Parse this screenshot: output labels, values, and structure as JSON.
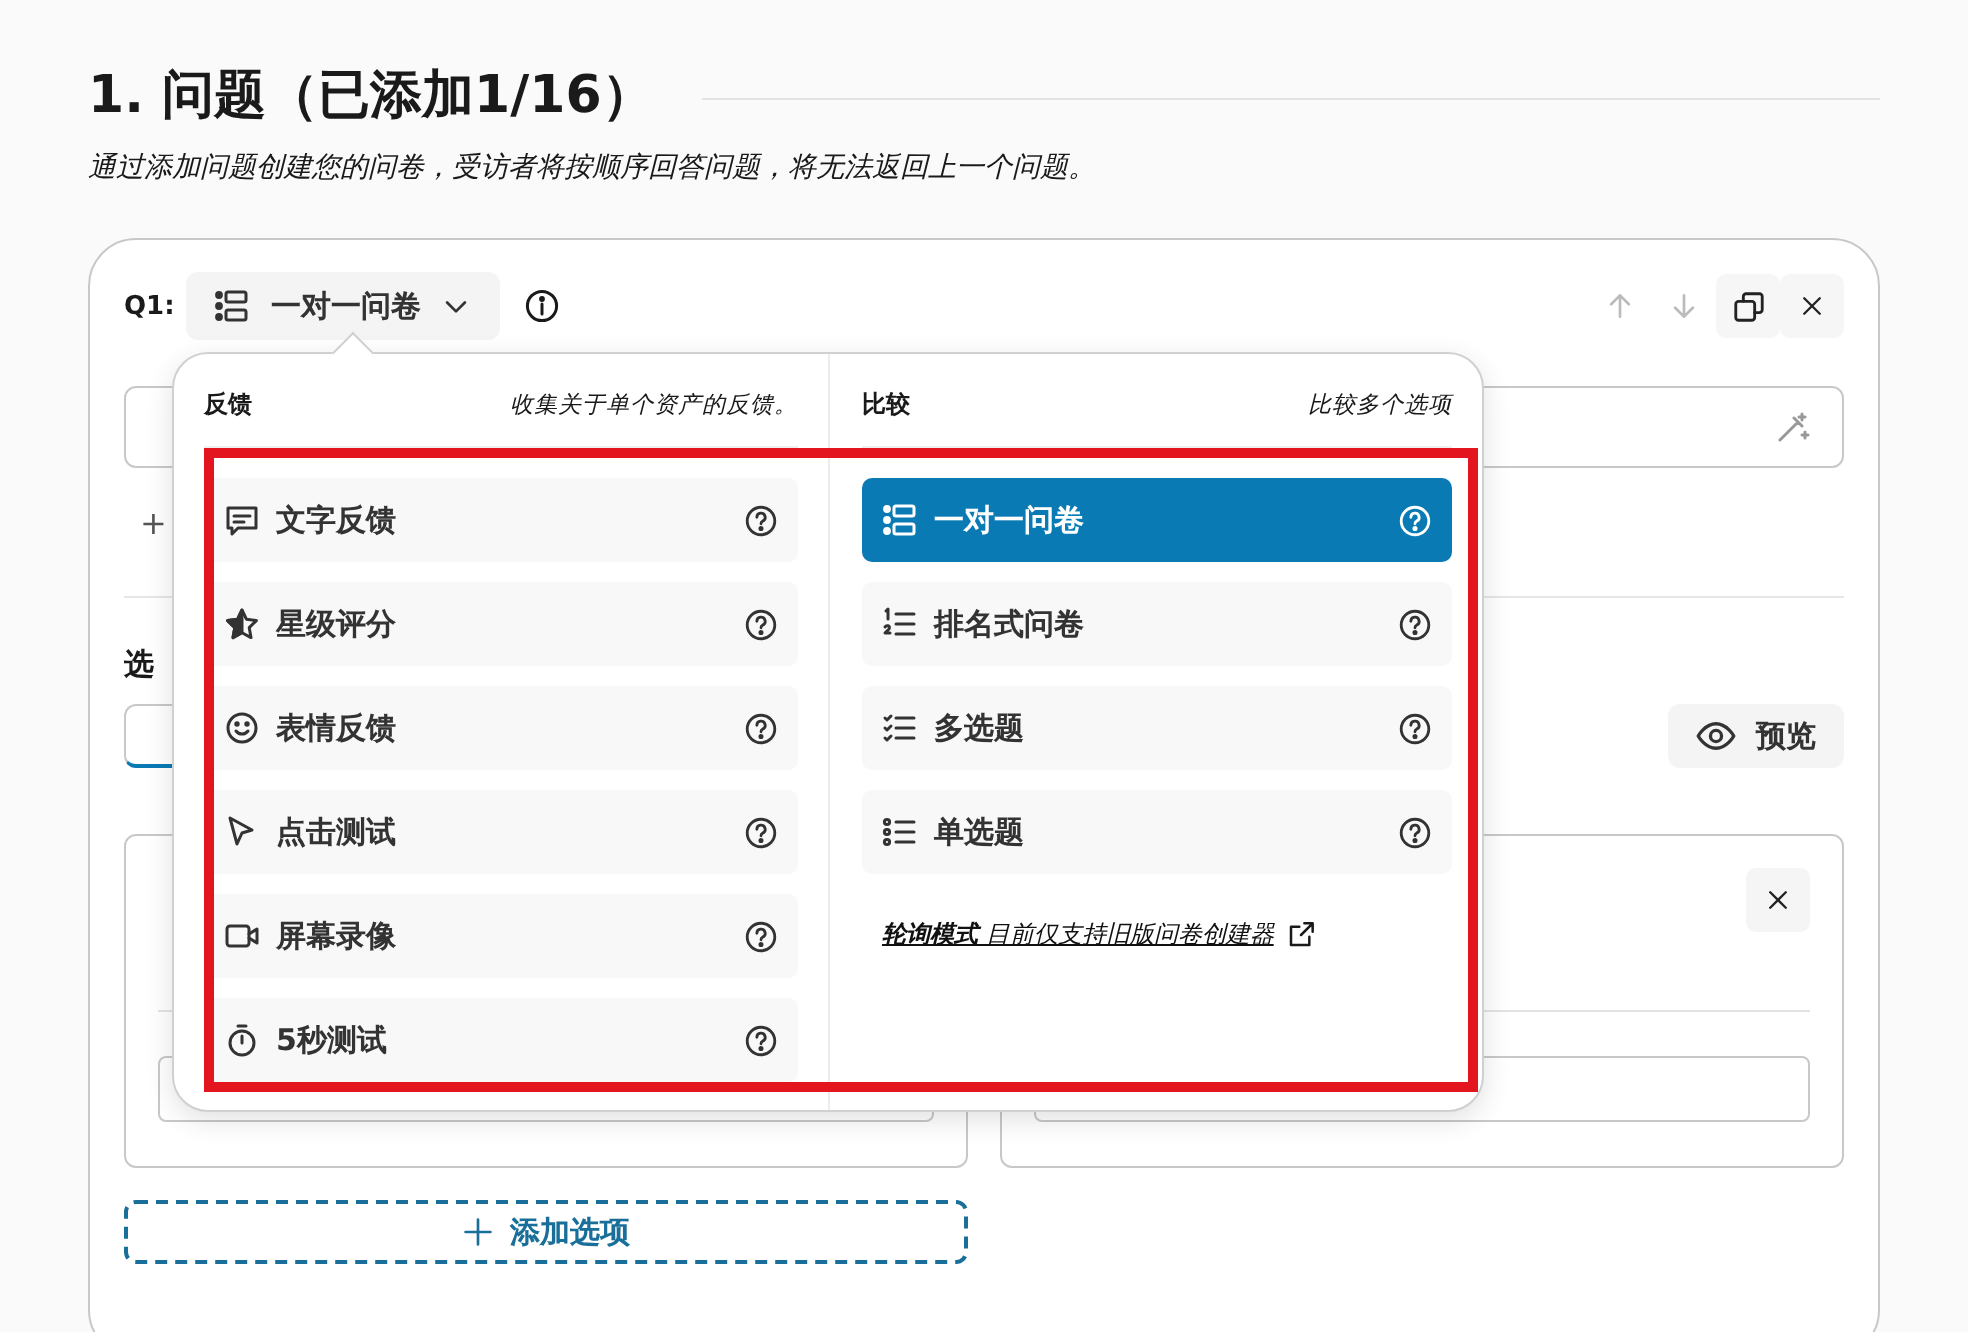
{
  "header": {
    "title": "1. 问题（已添加1/16）",
    "subtitle": "通过添加问题创建您的问卷，受访者将按顺序回答问题，将无法返回上一个问题。"
  },
  "question": {
    "label": "Q1:",
    "type_button": "一对一问卷",
    "actions": [
      {
        "kind": "up",
        "disabled": true
      },
      {
        "kind": "down",
        "disabled": true
      },
      {
        "kind": "copy",
        "disabled": false
      },
      {
        "kind": "close",
        "disabled": false
      }
    ]
  },
  "behind": {
    "add_symbol": "+",
    "section_label": "选",
    "preview_button": "预览"
  },
  "menu": {
    "columns": [
      {
        "title": "反馈",
        "description": "收集关于单个资产的反馈。",
        "items": [
          {
            "kind": "comment",
            "label": "文字反馈",
            "selected": false
          },
          {
            "kind": "star",
            "label": "星级评分",
            "selected": false
          },
          {
            "kind": "smile",
            "label": "表情反馈",
            "selected": false
          },
          {
            "kind": "pointer",
            "label": "点击测试",
            "selected": false
          },
          {
            "kind": "video",
            "label": "屏幕录像",
            "selected": false
          },
          {
            "kind": "timer",
            "label": "5秒测试",
            "selected": false
          }
        ]
      },
      {
        "title": "比较",
        "description": "比较多个选项",
        "items": [
          {
            "kind": "pairs",
            "label": "一对一问卷",
            "selected": true
          },
          {
            "kind": "ranked",
            "label": "排名式问卷",
            "selected": false
          },
          {
            "kind": "checklist",
            "label": "多选题",
            "selected": false
          },
          {
            "kind": "bullets",
            "label": "单选题",
            "selected": false
          }
        ],
        "note": "**轮询模式** 目前仅支持旧版问卷创建器"
      }
    ]
  },
  "add_option": "添加选项"
}
